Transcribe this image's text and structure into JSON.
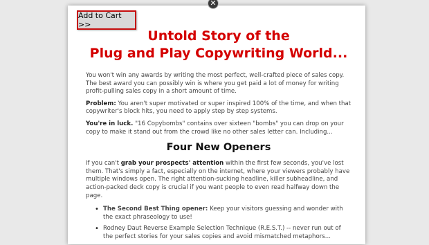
{
  "close_glyph": "✕",
  "cart_button": "Add to Cart >>",
  "headline_line1": "Untold Story of the",
  "headline_line2": "Plug and Play Copywriting World...",
  "para1": "You won't win any awards by writing the most perfect, well-crafted piece of sales copy. The best award you can possibly win is where you get paid a lot of money for writing profit-pulling sales copy in a short amount of time.",
  "para2_bold": "Problem:",
  "para2_rest": " You aren't super motivated or super inspired 100% of the time, and when that copywriter's block hits, you need to apply step by step systems.",
  "para3_bold": "You're in luck.",
  "para3_rest": " \"16 Copybombs\" contains over sixteen \"bombs\" you can drop on your copy to make it stand out from the crowd like no other sales letter can. Including...",
  "section_title": "Four New Openers",
  "para4_a": "If you can't ",
  "para4_bold": "grab your prospects' attention",
  "para4_b": " within the first few seconds, you've lost them. That's simply a fact, especially on the internet, where your viewers probably have multiple windows open. The right attention-sucking headline, killer subheadline, and action-packed deck copy is crucial if you want people to even read halfway down the page.",
  "bullet1_bold": "The Second Best Thing opener:",
  "bullet1_rest": " Keep your visitors guessing and wonder with the exact phraseology to use!",
  "bullet2": "Rodney Daut Reverse Example Selection Technique (R.E.S.T.) -- never run out of the perfect stories for your sales copies and avoid mismatched metaphors...",
  "colors": {
    "headline": "#d40000",
    "cart_border": "#c50c0c"
  }
}
